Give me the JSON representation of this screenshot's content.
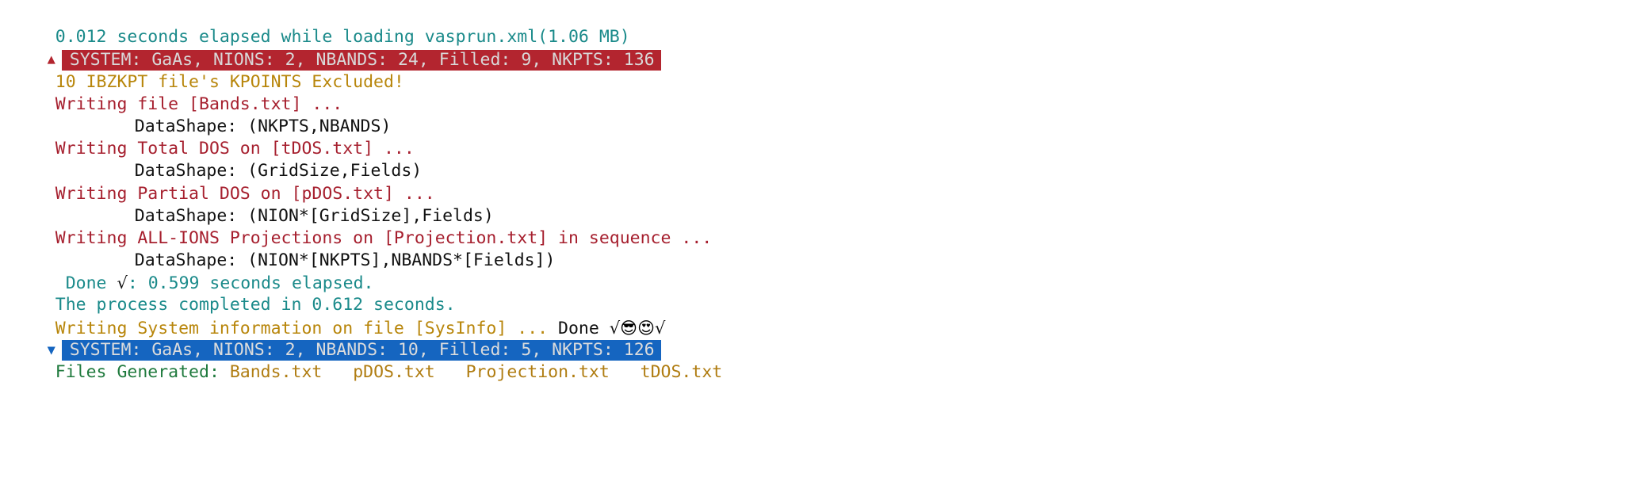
{
  "terminal": {
    "background": "#ffffff",
    "colors": {
      "teal": "#1a8a8a",
      "gold": "#b8860b",
      "crimson": "#a61f2e",
      "black": "#111111",
      "green": "#1f7a3d",
      "olive": "#b07d12",
      "bar_red": "#b3252f",
      "bar_blue": "#1565c0",
      "bar_text": "#d9d9d9"
    },
    "lines": {
      "load_time": "0.012 seconds elapsed while loading vasprun.xml(1.06 MB)",
      "system_top_marker": "▲",
      "system_top": "SYSTEM: GaAs, NIONS: 2, NBANDS: 24, Filled: 9, NKPTS: 136",
      "ibzkpt_excluded": "10 IBZKPT file's KPOINTS Excluded!",
      "writing_bands": "Writing file [Bands.txt] ...",
      "shape_bands": "DataShape: (NKPTS,NBANDS)",
      "writing_tdos": "Writing Total DOS on [tDOS.txt] ...",
      "shape_tdos": "DataShape: (GridSize,Fields)",
      "writing_pdos": "Writing Partial DOS on [pDOS.txt] ...",
      "shape_pdos": "DataShape: (NION*[GridSize],Fields)",
      "writing_projection": "Writing ALL-IONS Projections on [Projection.txt] in sequence ...",
      "shape_projection": "DataShape: (NION*[NKPTS],NBANDS*[Fields])",
      "done_prefix": " Done ",
      "done_check": "√",
      "done_suffix": ": 0.599 seconds elapsed.",
      "process_completed": "The process completed in 0.612 seconds.",
      "sysinfo_write": "Writing System information on file [SysInfo] ... ",
      "sysinfo_done": "Done ",
      "sysinfo_check1": "√",
      "sysinfo_emoji1": "😎",
      "sysinfo_emoji2": "😍",
      "sysinfo_check2": "√",
      "system_bottom_marker": "▼",
      "system_bottom": "SYSTEM: GaAs, NIONS: 2, NBANDS: 10, Filled: 5, NKPTS: 126",
      "files_generated_label": "Files Generated: ",
      "files": [
        "Bands.txt",
        "pDOS.txt",
        "Projection.txt",
        "tDOS.txt"
      ],
      "file_gap": "   "
    }
  }
}
